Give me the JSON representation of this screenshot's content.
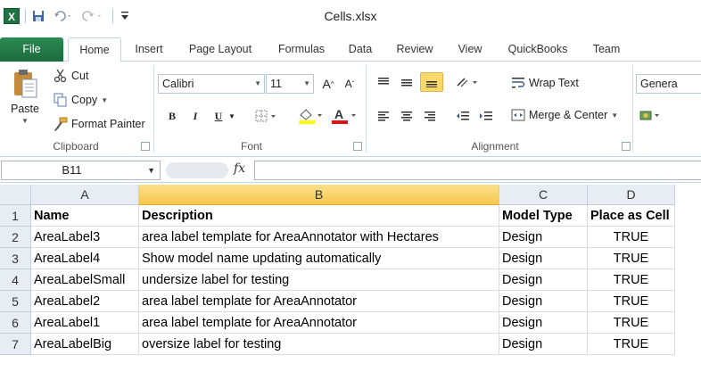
{
  "title": "Cells.xlsx",
  "quick_access": {
    "excel_icon": "excel-icon",
    "save_icon": "save-icon",
    "undo_icon": "undo-icon",
    "redo_icon": "redo-icon"
  },
  "tabs": [
    {
      "label": "File"
    },
    {
      "label": "Home"
    },
    {
      "label": "Insert"
    },
    {
      "label": "Page Layout"
    },
    {
      "label": "Formulas"
    },
    {
      "label": "Data"
    },
    {
      "label": "Review"
    },
    {
      "label": "View"
    },
    {
      "label": "QuickBooks"
    },
    {
      "label": "Team"
    }
  ],
  "ribbon": {
    "clipboard": {
      "label": "Clipboard",
      "paste": "Paste",
      "cut": "Cut",
      "copy": "Copy",
      "format_painter": "Format Painter"
    },
    "font": {
      "label": "Font",
      "font_name": "Calibri",
      "font_size": "11",
      "bold": "B",
      "italic": "I",
      "underline": "U"
    },
    "alignment": {
      "label": "Alignment",
      "wrap_text": "Wrap Text",
      "merge_center": "Merge & Center"
    },
    "number": {
      "format": "Genera"
    }
  },
  "formula_bar": {
    "name_box": "B11",
    "fx": "fx",
    "formula": ""
  },
  "grid": {
    "columns": [
      "A",
      "B",
      "C",
      "D"
    ],
    "rows": [
      {
        "num": "1",
        "cells": [
          "Name",
          "Description",
          "Model Type",
          "Place as Cell"
        ]
      },
      {
        "num": "2",
        "cells": [
          "AreaLabel3",
          "area label template for AreaAnnotator with Hectares",
          "Design",
          "TRUE"
        ]
      },
      {
        "num": "3",
        "cells": [
          "AreaLabel4",
          "Show model name updating automatically",
          "Design",
          "TRUE"
        ]
      },
      {
        "num": "4",
        "cells": [
          "AreaLabelSmall",
          "undersize label for testing",
          "Design",
          "TRUE"
        ]
      },
      {
        "num": "5",
        "cells": [
          "AreaLabel2",
          "area label template for AreaAnnotator",
          "Design",
          "TRUE"
        ]
      },
      {
        "num": "6",
        "cells": [
          "AreaLabel1",
          "area label template for AreaAnnotator",
          "Design",
          "TRUE"
        ]
      },
      {
        "num": "7",
        "cells": [
          "AreaLabelBig",
          "oversize label for testing",
          "Design",
          "TRUE"
        ]
      }
    ]
  },
  "colors": {
    "file_tab": "#1d6b3e",
    "selected_header": "#f6c84b",
    "highlight": "#fcd96b"
  }
}
